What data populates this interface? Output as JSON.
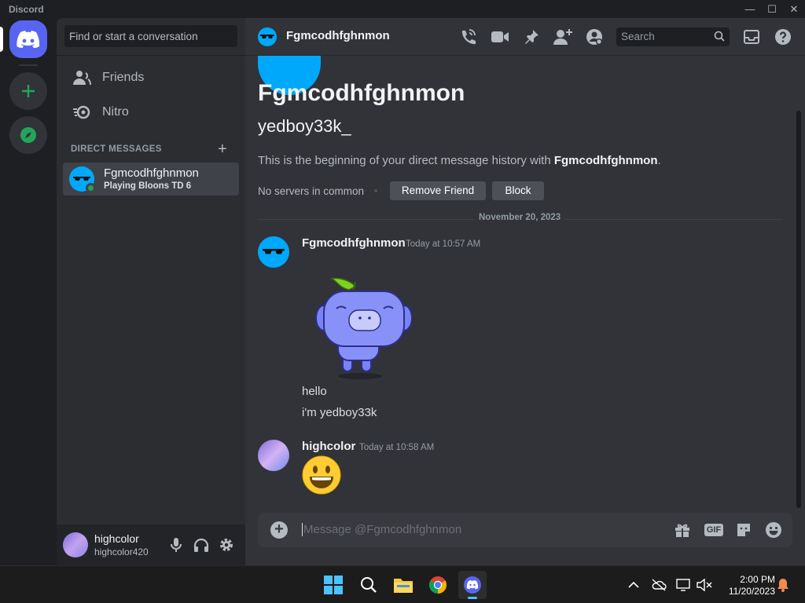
{
  "window": {
    "title": "Discord",
    "minimize": "—",
    "maximize": "☐",
    "close": "✕"
  },
  "sidebar": {
    "search_placeholder": "Find or start a conversation",
    "nav": [
      {
        "label": "Friends"
      },
      {
        "label": "Nitro"
      }
    ],
    "dm_header": "DIRECT MESSAGES",
    "dm_add": "+",
    "dms": [
      {
        "name": "Fgmcodhfghnmon",
        "activity": "Playing Bloons TD 6"
      }
    ]
  },
  "user_panel": {
    "name": "highcolor",
    "tag": "highcolor420"
  },
  "channel": {
    "name": "Fgmcodhfghnmon",
    "search_placeholder": "Search"
  },
  "intro": {
    "title": "Fgmcodhfghnmon",
    "username": "yedboy33k_",
    "text_prefix": "This is the beginning of your direct message history with ",
    "text_name": "Fgmcodhfghnmon",
    "text_suffix": ".",
    "no_servers": "No servers in common",
    "remove_friend": "Remove Friend",
    "block": "Block"
  },
  "date_divider": "November 20, 2023",
  "messages": [
    {
      "author": "Fgmcodhfghnmon",
      "time": "Today at 10:57 AM",
      "lines": [
        "hello",
        "i'm yedboy33k"
      ]
    },
    {
      "author": "highcolor",
      "time": "Today at 10:58 AM",
      "emoji": "😃"
    }
  ],
  "composer": {
    "placeholder": "Message @Fgmcodhfghnmon",
    "gif_label": "GIF"
  },
  "taskbar": {
    "time": "2:00 PM",
    "date": "11/20/2023"
  },
  "colors": {
    "blurple": "#5865f2",
    "green": "#23a559",
    "bg_main": "#313338",
    "bg_sidebar": "#2b2d31",
    "bg_servers": "#1e1f22"
  }
}
